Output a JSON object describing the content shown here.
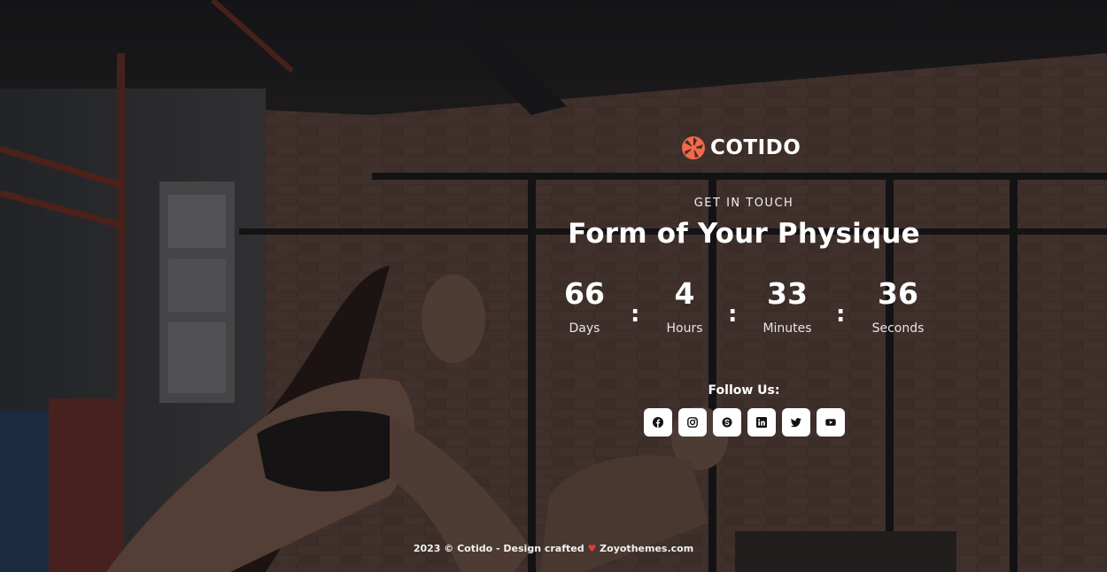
{
  "brand": {
    "name": "COTIDO",
    "accent": "#f26a4b"
  },
  "hero": {
    "eyebrow": "GET IN TOUCH",
    "headline": "Form of Your Physique"
  },
  "countdown": {
    "separator": ":",
    "days": {
      "value": "66",
      "label": "Days"
    },
    "hours": {
      "value": "4",
      "label": "Hours"
    },
    "minutes": {
      "value": "33",
      "label": "Minutes"
    },
    "seconds": {
      "value": "36",
      "label": "Seconds"
    }
  },
  "social": {
    "heading": "Follow Us:",
    "icons": [
      "facebook-icon",
      "instagram-icon",
      "skype-icon",
      "linkedin-icon",
      "twitter-icon",
      "youtube-icon"
    ]
  },
  "footer": {
    "prefix": "2023 © Cotido - Design crafted",
    "heart": "♥",
    "suffix": "Zoyothemes.com"
  }
}
